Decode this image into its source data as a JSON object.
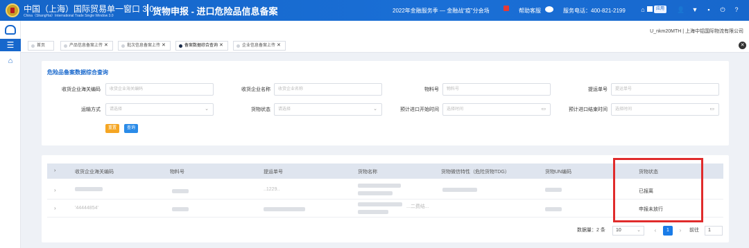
{
  "header": {
    "brand_cn": "中国（上海）国际贸易单一窗口 3.0",
    "brand_en": "China（ShangHai）International Trade Single Window 3.0",
    "system_title": "货物申报 - 进口危险品信息备案",
    "promo": "2022年金融服务季 — 金融战“疫”分会场",
    "help": "帮助客服",
    "phone": "服务电话：400-821-2199",
    "apps_label": "应用",
    "icons": [
      "home-icon",
      "apps-icon",
      "user-icon",
      "shirt-icon",
      "message-icon",
      "power-icon",
      "help-icon"
    ]
  },
  "user": {
    "label": "U_nkm20MTH | 上海中铝国际物流有限公司"
  },
  "tabs": [
    {
      "label": "首页",
      "closable": false
    },
    {
      "label": "产品信息备案上传",
      "closable": true
    },
    {
      "label": "批次信息备案上传",
      "closable": true
    },
    {
      "label": "备案数据综合查询",
      "closable": true,
      "active": true
    },
    {
      "label": "企业信息备案上传",
      "closable": true
    }
  ],
  "search": {
    "title": "危险品备案数据综合查询",
    "fields": [
      {
        "label": "收货企业海关编码",
        "placeholder": "收货企业海关编码"
      },
      {
        "label": "收货企业名称",
        "placeholder": "收货企业名称"
      },
      {
        "label": "物料号",
        "placeholder": "物料号"
      },
      {
        "label": "提运单号",
        "placeholder": "提运单号"
      },
      {
        "label": "运输方式",
        "placeholder": "请选择"
      },
      {
        "label": "货物状态",
        "placeholder": "请选择"
      },
      {
        "label": "预计进口开始时间",
        "placeholder": "选择时间"
      },
      {
        "label": "预计进口结束时间",
        "placeholder": "选择时间"
      }
    ],
    "reset_label": "重置",
    "query_label": "查询"
  },
  "table": {
    "headers": [
      "收货企业海关编码",
      "物料号",
      "提运单号",
      "货物名称",
      "货物微信特性（危险货物TDG）",
      "货物UN编码",
      "货物状态"
    ],
    "rows": [
      {
        "partial_bill": "..1229..",
        "status": "已报离"
      },
      {
        "partial_code": "'44444854'",
        "partial_name": "...二费结...",
        "status": "申报未放行"
      }
    ]
  },
  "pagination": {
    "total_label": "数据量：2 条",
    "page_size": "10",
    "current_page": "1",
    "goto_label": "前往",
    "goto_value": "1"
  }
}
